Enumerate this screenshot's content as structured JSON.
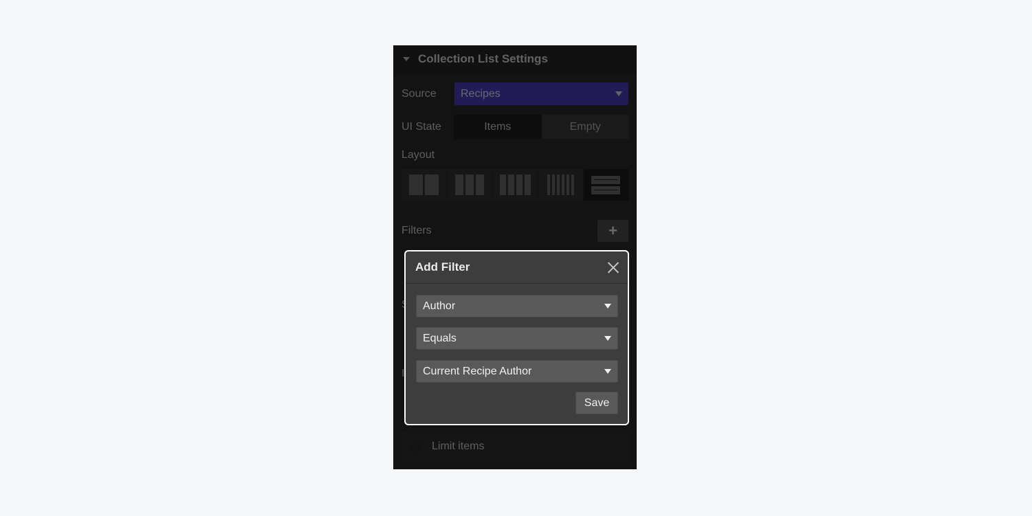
{
  "panel": {
    "title": "Collection List Settings",
    "source": {
      "label": "Source",
      "value": "Recipes",
      "accent": "#4b3cbf"
    },
    "ui_state": {
      "label": "UI State",
      "options": [
        "Items",
        "Empty"
      ],
      "selected": "Items"
    },
    "layout": {
      "label": "Layout",
      "options": [
        "2-columns",
        "3-columns",
        "4-columns",
        "6-columns",
        "list"
      ],
      "selected": "list"
    },
    "filters": {
      "label": "Filters",
      "add_label": "+"
    },
    "hidden_labels": [
      "S",
      "I"
    ],
    "limit": {
      "label": "Limit items",
      "checked": false
    }
  },
  "modal": {
    "title": "Add Filter",
    "field": "Author",
    "operator": "Equals",
    "value": "Current Recipe Author",
    "save_label": "Save"
  }
}
